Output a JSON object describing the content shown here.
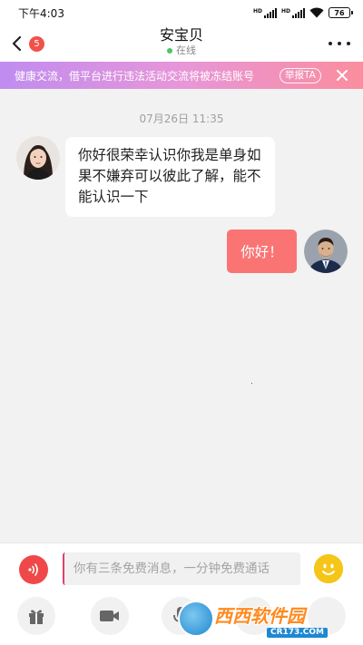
{
  "status_bar": {
    "time": "下午4:03",
    "signal1_label": "HD",
    "signal2_label": "HD",
    "battery": "76"
  },
  "header": {
    "unread_count": "5",
    "contact_name": "安宝贝",
    "status": "在线"
  },
  "notice": {
    "text": "健康交流，借平台进行违法活动交流将被冻结账号",
    "report_label": "举报TA"
  },
  "chat": {
    "timestamp": "07月26日  11:35",
    "messages": [
      {
        "from": "them",
        "text": "你好很荣幸认识你我是单身如果不嫌弃可以彼此了解，能不能认识一下"
      },
      {
        "from": "me",
        "text": "你好！"
      }
    ]
  },
  "composer": {
    "placeholder": "你有三条免费消息，一分钟免费通话",
    "value": ""
  },
  "toolbar": {
    "icons": [
      "gift-icon",
      "video-icon",
      "mic-icon",
      "tool-icon",
      "tool-icon"
    ]
  },
  "watermark": {
    "text": "西西软件园",
    "url": "CR173.COM"
  },
  "colors": {
    "accent": "#fb7474",
    "voice": "#f04848",
    "online": "#4cc36a",
    "badge": "#f0524a"
  }
}
